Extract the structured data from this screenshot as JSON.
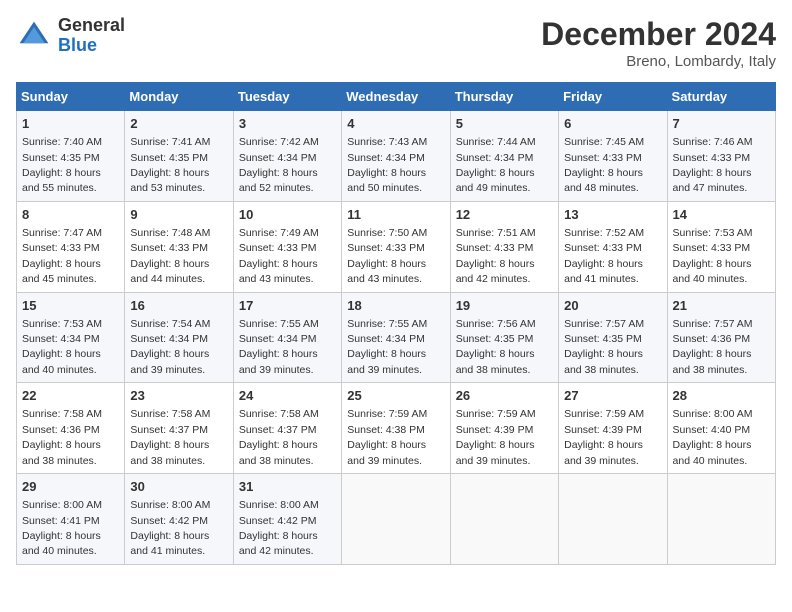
{
  "header": {
    "logo_general": "General",
    "logo_blue": "Blue",
    "month_title": "December 2024",
    "location": "Breno, Lombardy, Italy"
  },
  "days_of_week": [
    "Sunday",
    "Monday",
    "Tuesday",
    "Wednesday",
    "Thursday",
    "Friday",
    "Saturday"
  ],
  "weeks": [
    [
      {
        "day": 1,
        "sunrise": "7:40 AM",
        "sunset": "4:35 PM",
        "daylight": "8 hours and 55 minutes."
      },
      {
        "day": 2,
        "sunrise": "7:41 AM",
        "sunset": "4:35 PM",
        "daylight": "8 hours and 53 minutes."
      },
      {
        "day": 3,
        "sunrise": "7:42 AM",
        "sunset": "4:34 PM",
        "daylight": "8 hours and 52 minutes."
      },
      {
        "day": 4,
        "sunrise": "7:43 AM",
        "sunset": "4:34 PM",
        "daylight": "8 hours and 50 minutes."
      },
      {
        "day": 5,
        "sunrise": "7:44 AM",
        "sunset": "4:34 PM",
        "daylight": "8 hours and 49 minutes."
      },
      {
        "day": 6,
        "sunrise": "7:45 AM",
        "sunset": "4:33 PM",
        "daylight": "8 hours and 48 minutes."
      },
      {
        "day": 7,
        "sunrise": "7:46 AM",
        "sunset": "4:33 PM",
        "daylight": "8 hours and 47 minutes."
      }
    ],
    [
      {
        "day": 8,
        "sunrise": "7:47 AM",
        "sunset": "4:33 PM",
        "daylight": "8 hours and 45 minutes."
      },
      {
        "day": 9,
        "sunrise": "7:48 AM",
        "sunset": "4:33 PM",
        "daylight": "8 hours and 44 minutes."
      },
      {
        "day": 10,
        "sunrise": "7:49 AM",
        "sunset": "4:33 PM",
        "daylight": "8 hours and 43 minutes."
      },
      {
        "day": 11,
        "sunrise": "7:50 AM",
        "sunset": "4:33 PM",
        "daylight": "8 hours and 43 minutes."
      },
      {
        "day": 12,
        "sunrise": "7:51 AM",
        "sunset": "4:33 PM",
        "daylight": "8 hours and 42 minutes."
      },
      {
        "day": 13,
        "sunrise": "7:52 AM",
        "sunset": "4:33 PM",
        "daylight": "8 hours and 41 minutes."
      },
      {
        "day": 14,
        "sunrise": "7:53 AM",
        "sunset": "4:33 PM",
        "daylight": "8 hours and 40 minutes."
      }
    ],
    [
      {
        "day": 15,
        "sunrise": "7:53 AM",
        "sunset": "4:34 PM",
        "daylight": "8 hours and 40 minutes."
      },
      {
        "day": 16,
        "sunrise": "7:54 AM",
        "sunset": "4:34 PM",
        "daylight": "8 hours and 39 minutes."
      },
      {
        "day": 17,
        "sunrise": "7:55 AM",
        "sunset": "4:34 PM",
        "daylight": "8 hours and 39 minutes."
      },
      {
        "day": 18,
        "sunrise": "7:55 AM",
        "sunset": "4:34 PM",
        "daylight": "8 hours and 39 minutes."
      },
      {
        "day": 19,
        "sunrise": "7:56 AM",
        "sunset": "4:35 PM",
        "daylight": "8 hours and 38 minutes."
      },
      {
        "day": 20,
        "sunrise": "7:57 AM",
        "sunset": "4:35 PM",
        "daylight": "8 hours and 38 minutes."
      },
      {
        "day": 21,
        "sunrise": "7:57 AM",
        "sunset": "4:36 PM",
        "daylight": "8 hours and 38 minutes."
      }
    ],
    [
      {
        "day": 22,
        "sunrise": "7:58 AM",
        "sunset": "4:36 PM",
        "daylight": "8 hours and 38 minutes."
      },
      {
        "day": 23,
        "sunrise": "7:58 AM",
        "sunset": "4:37 PM",
        "daylight": "8 hours and 38 minutes."
      },
      {
        "day": 24,
        "sunrise": "7:58 AM",
        "sunset": "4:37 PM",
        "daylight": "8 hours and 38 minutes."
      },
      {
        "day": 25,
        "sunrise": "7:59 AM",
        "sunset": "4:38 PM",
        "daylight": "8 hours and 39 minutes."
      },
      {
        "day": 26,
        "sunrise": "7:59 AM",
        "sunset": "4:39 PM",
        "daylight": "8 hours and 39 minutes."
      },
      {
        "day": 27,
        "sunrise": "7:59 AM",
        "sunset": "4:39 PM",
        "daylight": "8 hours and 39 minutes."
      },
      {
        "day": 28,
        "sunrise": "8:00 AM",
        "sunset": "4:40 PM",
        "daylight": "8 hours and 40 minutes."
      }
    ],
    [
      {
        "day": 29,
        "sunrise": "8:00 AM",
        "sunset": "4:41 PM",
        "daylight": "8 hours and 40 minutes."
      },
      {
        "day": 30,
        "sunrise": "8:00 AM",
        "sunset": "4:42 PM",
        "daylight": "8 hours and 41 minutes."
      },
      {
        "day": 31,
        "sunrise": "8:00 AM",
        "sunset": "4:42 PM",
        "daylight": "8 hours and 42 minutes."
      },
      null,
      null,
      null,
      null
    ]
  ]
}
